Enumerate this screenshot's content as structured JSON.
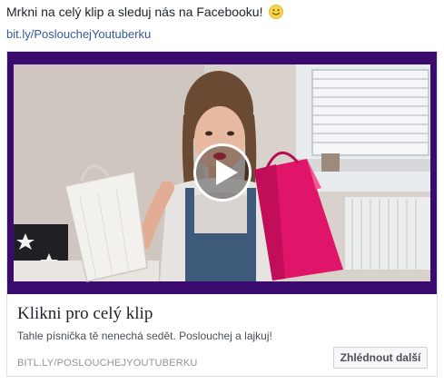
{
  "post": {
    "message": "Mrkni na celý klip a sleduj nás na Facebooku!",
    "emoji_icon": "smiley-emoji-icon",
    "link": "bit.ly/PoslouchejYoutuberku"
  },
  "card": {
    "play_icon": "play-icon",
    "title": "Klikni pro celý klip",
    "description": "Tahle písnička tě nenechá sedět. Poslouchej a lajkuj!",
    "domain": "BITL.LY/POSLOUCHEJYOUTUBERKU",
    "cta_label": "Zhlédnout další"
  },
  "colors": {
    "link": "#365899",
    "video_frame": "#3b0a6e",
    "text": "#1d2129",
    "muted": "#90949c"
  }
}
